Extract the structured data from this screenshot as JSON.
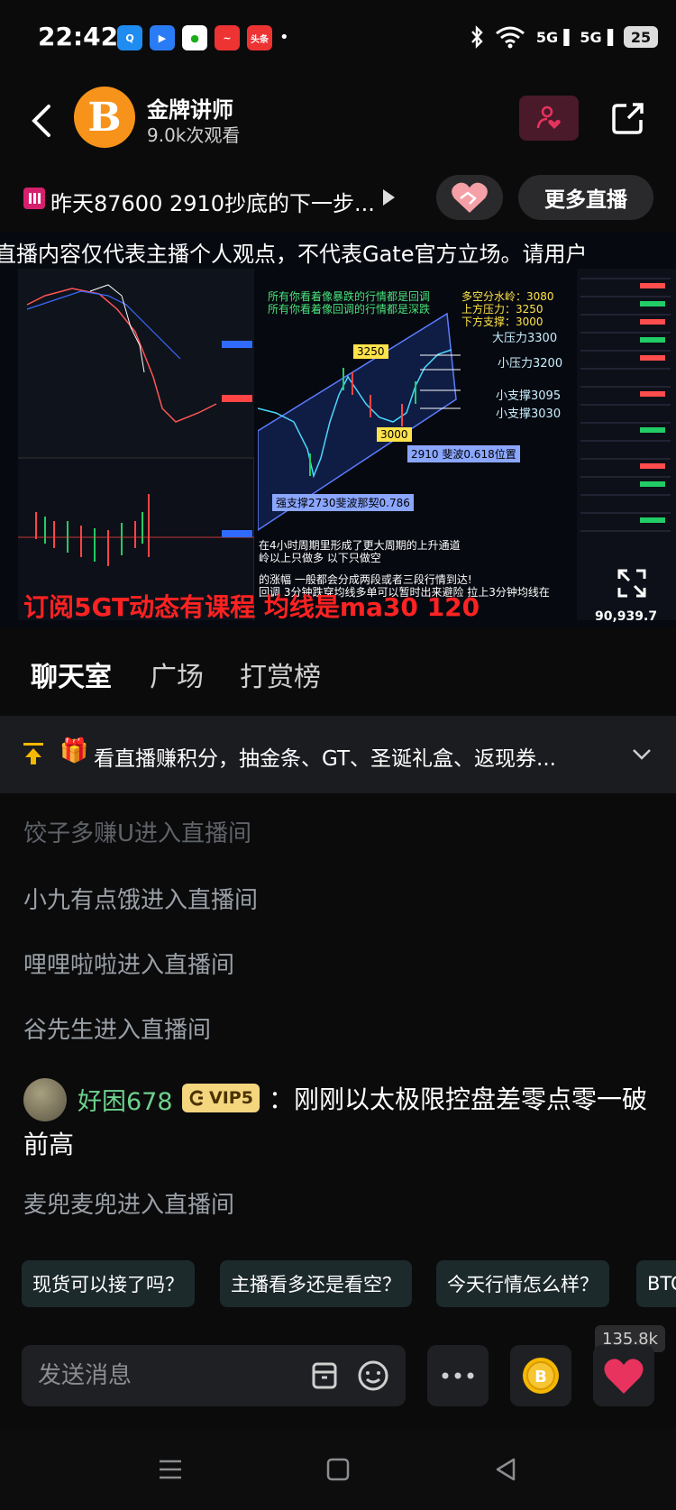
{
  "status_bar": {
    "time": "22:42",
    "app_icons": [
      "qq",
      "maps",
      "wechat",
      "stocks",
      "头条"
    ],
    "network_1": "5G",
    "network_2": "5G",
    "battery": "25"
  },
  "header": {
    "streamer_name": "金牌讲师",
    "viewers": "9.0k次观看",
    "avatar_glyph": "B"
  },
  "stream": {
    "title": "昨天87600 2910抄底的下一步...",
    "more_live": "更多直播"
  },
  "video": {
    "disclaimer": "直播内容仅代表主播个人观点，不代表Gate官方立场。请用户",
    "note_green_1": "所有你看着像暴跌的行情都是回调",
    "note_green_2": "所有你看着像回调的行情都是深跌",
    "note_yellow_1": "多空分水岭：3080",
    "note_yellow_2": "上方压力：3250",
    "note_yellow_3": "下方支撑：3000",
    "level_1": "大压力3300",
    "level_2": "小压力3200",
    "level_3": "小支撑3095",
    "level_4": "小支撑3030",
    "tag_3250": "3250",
    "tag_3000": "3000",
    "fib_note": "2910 斐波0.618位置",
    "strong_support": "强支撑2730斐波那契0.786",
    "annot_1": "在4小时周期里形成了更大周期的上升通道",
    "annot_2": "岭以上只做多  以下只做空",
    "annot_3": "的涨幅 一般都会分成两段或者三段行情到达!",
    "annot_4": "回调 3分钟跌穿均线多单可以暂时出来避险  拉上3分钟均线在",
    "overlay_red": "订阅5GT动态有课程   均线是ma30 120",
    "price_readout": "90,939.7"
  },
  "tabs": [
    {
      "label": "聊天室",
      "active": true
    },
    {
      "label": "广场",
      "active": false
    },
    {
      "label": "打赏榜",
      "active": false
    }
  ],
  "promo": {
    "text": "看直播赚积分，抽金条、GT、圣诞礼盒、返现券..."
  },
  "chat": {
    "system_messages": [
      "饺子多赚U进入直播间",
      "小九有点饿进入直播间",
      "哩哩啦啦进入直播间",
      "谷先生进入直播间",
      "麦兜麦兜进入直播间"
    ],
    "user_message": {
      "username": "好困678",
      "vip": "VIP5",
      "text_line1": "：刚刚以太极限控盘差零点零一破",
      "text_line2": "前高"
    }
  },
  "suggestions": [
    "现货可以接了吗？",
    "主播看多还是看空？",
    "今天行情怎么样？",
    "BTC"
  ],
  "input": {
    "placeholder": "发送消息",
    "likes_count": "135.8k"
  },
  "colors": {
    "accent_pink": "#e8335f",
    "vip_gold": "#f4d67e",
    "username_green": "#6fd18d",
    "overlay_red": "#ff2222"
  }
}
